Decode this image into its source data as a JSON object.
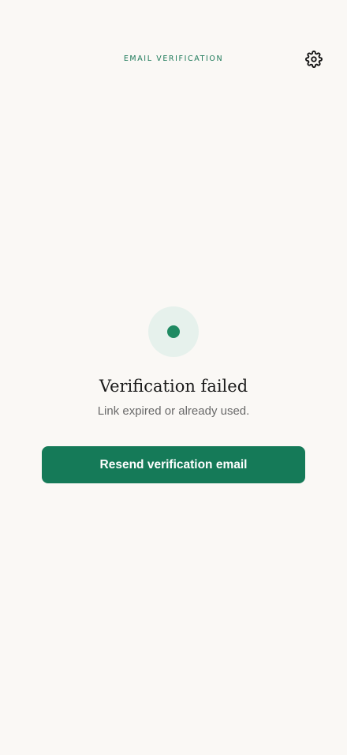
{
  "header": {
    "title": "EMAIL VERIFICATION",
    "settings_icon": "gear-icon"
  },
  "status": {
    "icon": "status-dot-icon",
    "title": "Verification failed",
    "message": "Link expired or already used."
  },
  "actions": {
    "resend_label": "Resend verification email"
  },
  "colors": {
    "background": "#faf8f5",
    "accent": "#157a58",
    "accent_soft": "#e6f1ec",
    "title_text": "#1b1b1b",
    "muted_text": "#6a6a6a"
  }
}
